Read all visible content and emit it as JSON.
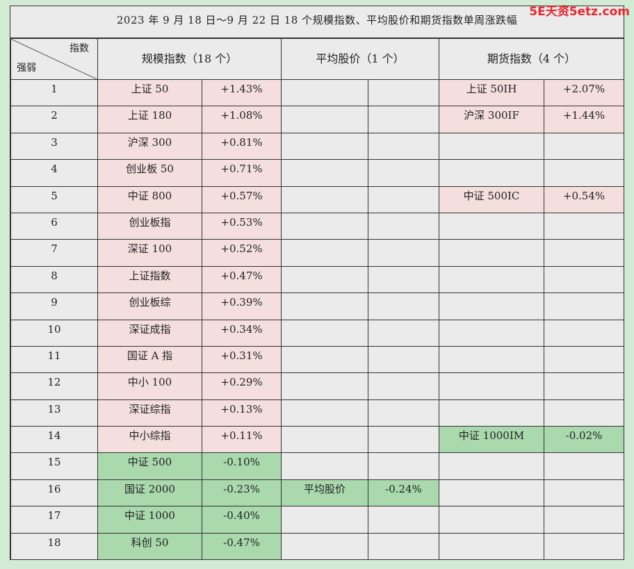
{
  "title": "2023 年 9 月 18 日～9 月 22 日 18 个规模指数、平均股价和期货指数单周涨跌幅",
  "watermark": "5E天资5etz.com",
  "corner": {
    "top": "指数",
    "bottom": "强弱"
  },
  "headers": {
    "scale": "规模指数（18 个）",
    "avg": "平均股价（1 个）",
    "futures": "期货指数（4 个）"
  },
  "colors": {
    "up": "#f5dede",
    "down": "#a9d9ad",
    "background": "#d3ebd5",
    "panel": "#ebebeb",
    "watermark": "#e8262d"
  },
  "rows": [
    {
      "rank": "1",
      "scale_name": "上证 50",
      "scale_val": "+1.43%",
      "scale_dir": "up",
      "avg_name": "",
      "avg_val": "",
      "avg_dir": "",
      "fut_name": "上证 50IH",
      "fut_val": "+2.07%",
      "fut_dir": "up"
    },
    {
      "rank": "2",
      "scale_name": "上证 180",
      "scale_val": "+1.08%",
      "scale_dir": "up",
      "avg_name": "",
      "avg_val": "",
      "avg_dir": "",
      "fut_name": "沪深 300IF",
      "fut_val": "+1.44%",
      "fut_dir": "up"
    },
    {
      "rank": "3",
      "scale_name": "沪深 300",
      "scale_val": "+0.81%",
      "scale_dir": "up",
      "avg_name": "",
      "avg_val": "",
      "avg_dir": "",
      "fut_name": "",
      "fut_val": "",
      "fut_dir": ""
    },
    {
      "rank": "4",
      "scale_name": "创业板 50",
      "scale_val": "+0.71%",
      "scale_dir": "up",
      "avg_name": "",
      "avg_val": "",
      "avg_dir": "",
      "fut_name": "",
      "fut_val": "",
      "fut_dir": ""
    },
    {
      "rank": "5",
      "scale_name": "中证 800",
      "scale_val": "+0.57%",
      "scale_dir": "up",
      "avg_name": "",
      "avg_val": "",
      "avg_dir": "",
      "fut_name": "中证 500IC",
      "fut_val": "+0.54%",
      "fut_dir": "up"
    },
    {
      "rank": "6",
      "scale_name": "创业板指",
      "scale_val": "+0.53%",
      "scale_dir": "up",
      "avg_name": "",
      "avg_val": "",
      "avg_dir": "",
      "fut_name": "",
      "fut_val": "",
      "fut_dir": ""
    },
    {
      "rank": "7",
      "scale_name": "深证 100",
      "scale_val": "+0.52%",
      "scale_dir": "up",
      "avg_name": "",
      "avg_val": "",
      "avg_dir": "",
      "fut_name": "",
      "fut_val": "",
      "fut_dir": ""
    },
    {
      "rank": "8",
      "scale_name": "上证指数",
      "scale_val": "+0.47%",
      "scale_dir": "up",
      "avg_name": "",
      "avg_val": "",
      "avg_dir": "",
      "fut_name": "",
      "fut_val": "",
      "fut_dir": ""
    },
    {
      "rank": "9",
      "scale_name": "创业板综",
      "scale_val": "+0.39%",
      "scale_dir": "up",
      "avg_name": "",
      "avg_val": "",
      "avg_dir": "",
      "fut_name": "",
      "fut_val": "",
      "fut_dir": ""
    },
    {
      "rank": "10",
      "scale_name": "深证成指",
      "scale_val": "+0.34%",
      "scale_dir": "up",
      "avg_name": "",
      "avg_val": "",
      "avg_dir": "",
      "fut_name": "",
      "fut_val": "",
      "fut_dir": ""
    },
    {
      "rank": "11",
      "scale_name": "国证 A 指",
      "scale_val": "+0.31%",
      "scale_dir": "up",
      "avg_name": "",
      "avg_val": "",
      "avg_dir": "",
      "fut_name": "",
      "fut_val": "",
      "fut_dir": ""
    },
    {
      "rank": "12",
      "scale_name": "中小 100",
      "scale_val": "+0.29%",
      "scale_dir": "up",
      "avg_name": "",
      "avg_val": "",
      "avg_dir": "",
      "fut_name": "",
      "fut_val": "",
      "fut_dir": ""
    },
    {
      "rank": "13",
      "scale_name": "深证综指",
      "scale_val": "+0.13%",
      "scale_dir": "up",
      "avg_name": "",
      "avg_val": "",
      "avg_dir": "",
      "fut_name": "",
      "fut_val": "",
      "fut_dir": ""
    },
    {
      "rank": "14",
      "scale_name": "中小综指",
      "scale_val": "+0.11%",
      "scale_dir": "up",
      "avg_name": "",
      "avg_val": "",
      "avg_dir": "",
      "fut_name": "中证 1000IM",
      "fut_val": "-0.02%",
      "fut_dir": "down"
    },
    {
      "rank": "15",
      "scale_name": "中证 500",
      "scale_val": "-0.10%",
      "scale_dir": "down",
      "avg_name": "",
      "avg_val": "",
      "avg_dir": "",
      "fut_name": "",
      "fut_val": "",
      "fut_dir": ""
    },
    {
      "rank": "16",
      "scale_name": "国证 2000",
      "scale_val": "-0.23%",
      "scale_dir": "down",
      "avg_name": "平均股价",
      "avg_val": "-0.24%",
      "avg_dir": "down",
      "fut_name": "",
      "fut_val": "",
      "fut_dir": ""
    },
    {
      "rank": "17",
      "scale_name": "中证 1000",
      "scale_val": "-0.40%",
      "scale_dir": "down",
      "avg_name": "",
      "avg_val": "",
      "avg_dir": "",
      "fut_name": "",
      "fut_val": "",
      "fut_dir": ""
    },
    {
      "rank": "18",
      "scale_name": "科创 50",
      "scale_val": "-0.47%",
      "scale_dir": "down",
      "avg_name": "",
      "avg_val": "",
      "avg_dir": "",
      "fut_name": "",
      "fut_val": "",
      "fut_dir": ""
    }
  ]
}
